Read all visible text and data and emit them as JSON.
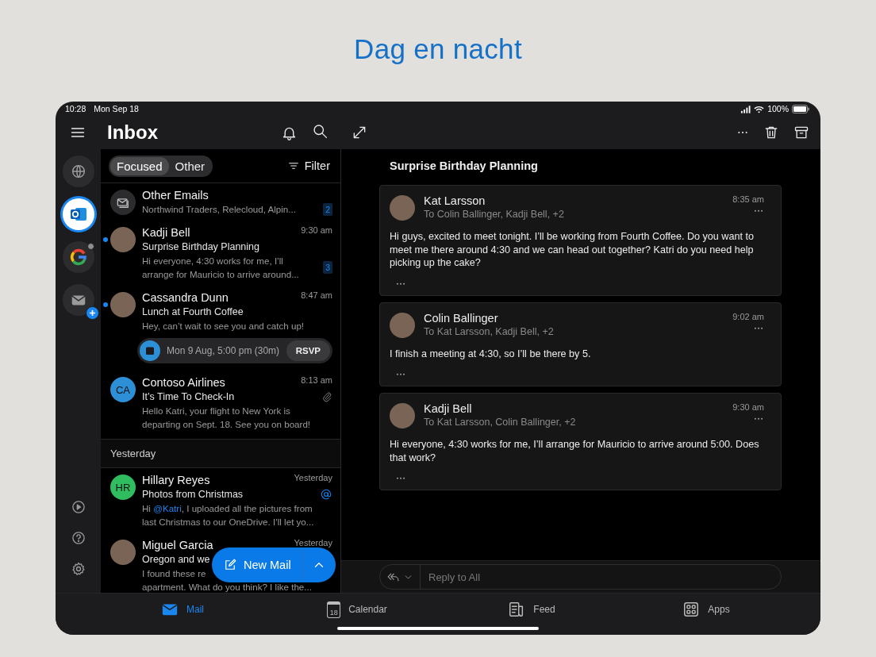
{
  "headline": "Dag en nacht",
  "status_bar": {
    "time": "10:28",
    "date": "Mon Sep 18",
    "battery": "100%"
  },
  "header": {
    "title": "Inbox"
  },
  "rail": {
    "accounts": [
      {
        "kind": "globe",
        "selected": false
      },
      {
        "kind": "outlook",
        "selected": true
      },
      {
        "kind": "google",
        "selected": false
      },
      {
        "kind": "add-mail",
        "selected": false
      }
    ]
  },
  "list": {
    "tabs": [
      {
        "label": "Focused",
        "selected": true
      },
      {
        "label": "Other",
        "selected": false
      }
    ],
    "filter": "Filter",
    "items": [
      {
        "kind": "group",
        "title": "Other Emails",
        "preview_lines": [
          "Northwind Traders, Relecloud, Alpin..."
        ],
        "count": "2"
      },
      {
        "kind": "message",
        "sender": "Kadji Bell",
        "time": "9:30 am",
        "unread": true,
        "avatar": {
          "kind": "photo"
        },
        "subject": "Surprise Birthday Planning",
        "preview_lines": [
          "Hi everyone, 4:30 works for me, I’ll",
          "arrange for Mauricio to arrive around..."
        ],
        "count": "3"
      },
      {
        "kind": "message",
        "sender": "Cassandra Dunn",
        "time": "8:47 am",
        "unread": true,
        "avatar": {
          "kind": "photo"
        },
        "subject": "Lunch at Fourth Coffee",
        "preview_lines": [
          "Hey, can’t wait to see you and catch up!"
        ],
        "event": {
          "text": "Mon 9 Aug, 5:00 pm (30m)",
          "action": "RSVP"
        }
      },
      {
        "kind": "message",
        "sender": "Contoso Airlines",
        "time": "8:13 am",
        "unread": false,
        "avatar": {
          "kind": "initials",
          "text": "CA",
          "color": "#2d8fd5"
        },
        "subject": "It’s Time To Check-In",
        "attachment": true,
        "preview_lines": [
          "Hello Katri, your flight to New York is",
          "departing on Sept. 18. See you on board!"
        ]
      },
      {
        "kind": "section",
        "label": "Yesterday"
      },
      {
        "kind": "message",
        "sender": "Hillary Reyes",
        "time": "Yesterday",
        "unread": false,
        "avatar": {
          "kind": "initials",
          "text": "HR",
          "color": "#2fbd5f"
        },
        "subject": "Photos from Christmas",
        "mention": true,
        "preview_lines": [
          [
            {
              "text": "Hi "
            },
            {
              "text": "@Katri",
              "kind": "mention"
            },
            {
              "text": ", I uploaded all the pictures from"
            }
          ],
          "last Christmas to our OneDrive. I’ll let yo..."
        ]
      },
      {
        "kind": "message",
        "sender": "Miguel Garcia",
        "time": "Yesterday",
        "unread": false,
        "avatar": {
          "kind": "photo"
        },
        "subject": "Oregon and we",
        "preview_lines": [
          "I found these re",
          "apartment. What do you think? I like the..."
        ]
      }
    ],
    "new_mail": {
      "label": "New Mail"
    }
  },
  "reading": {
    "subject": "Surprise Birthday Planning",
    "messages": [
      {
        "sender": "Kat Larsson",
        "to": "To Colin Ballinger, Kadji Bell, +2",
        "time": "8:35 am",
        "body": "Hi guys, excited to meet tonight. I’ll be working from Fourth Coffee. Do you want to meet me there around 4:30 and we can head out together? Katri do you need help picking up the cake?"
      },
      {
        "sender": "Colin Ballinger",
        "to": "To Kat Larsson, Kadji Bell, +2",
        "time": "9:02 am",
        "body": "I finish a meeting at 4:30, so I’ll be there by 5."
      },
      {
        "sender": "Kadji Bell",
        "to": "To Kat Larsson, Colin Ballinger, +2",
        "time": "9:30 am",
        "body": "Hi everyone, 4:30 works for me, I’ll arrange for Mauricio to arrive around 5:00. Does that work?"
      }
    ],
    "reply": {
      "placeholder": "Reply to All"
    }
  },
  "tabs": [
    {
      "kind": "mail",
      "label": "Mail",
      "selected": true
    },
    {
      "kind": "calendar",
      "label": "Calendar",
      "selected": false,
      "icon_text": "18"
    },
    {
      "kind": "feed",
      "label": "Feed",
      "selected": false
    },
    {
      "kind": "apps",
      "label": "Apps",
      "selected": false
    }
  ]
}
